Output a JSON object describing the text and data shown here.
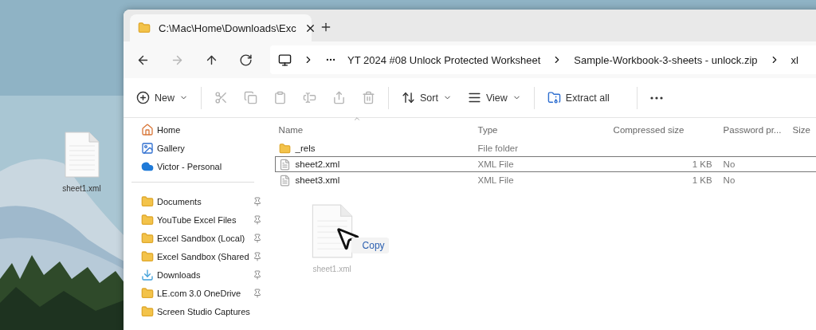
{
  "desktop": {
    "icons": [
      {
        "label": "sheet1.xml"
      }
    ]
  },
  "window": {
    "tabs": [
      {
        "label": "C:\\Mac\\Home\\Downloads\\Exc",
        "selected": true
      }
    ],
    "nav": [
      {
        "kind": "back",
        "disabled": false
      },
      {
        "kind": "forward",
        "disabled": true
      },
      {
        "kind": "up",
        "disabled": false
      },
      {
        "kind": "refresh",
        "disabled": false
      }
    ],
    "address": {
      "crumbs": [
        "YT 2024 #08 Unlock Protected Worksheet",
        "Sample-Workbook-3-sheets - unlock.zip",
        "xl"
      ]
    },
    "toolbar": [
      {
        "kind": "new",
        "label": "New",
        "disabled": false
      },
      {
        "kind": "cut",
        "disabled": true
      },
      {
        "kind": "copy",
        "disabled": true
      },
      {
        "kind": "paste",
        "disabled": true
      },
      {
        "kind": "rename",
        "disabled": true
      },
      {
        "kind": "share",
        "disabled": true
      },
      {
        "kind": "delete",
        "disabled": true
      },
      {
        "kind": "sort",
        "label": "Sort",
        "disabled": false
      },
      {
        "kind": "view",
        "label": "View",
        "disabled": false
      },
      {
        "kind": "extract",
        "label": "Extract all",
        "disabled": false
      },
      {
        "kind": "more",
        "disabled": false
      }
    ],
    "sidebar": {
      "top": [
        {
          "kind": "home",
          "label": "Home"
        },
        {
          "kind": "gallery",
          "label": "Gallery"
        },
        {
          "kind": "cloud",
          "label": "Victor - Personal"
        }
      ],
      "quick": [
        {
          "kind": "folder",
          "label": "Documents",
          "pinned": true
        },
        {
          "kind": "folder",
          "label": "YouTube Excel Files",
          "pinned": true
        },
        {
          "kind": "folder",
          "label": "Excel Sandbox (Local)",
          "pinned": true
        },
        {
          "kind": "folder",
          "label": "Excel Sandbox (Shared",
          "pinned": true
        },
        {
          "kind": "downloads",
          "label": "Downloads",
          "pinned": true
        },
        {
          "kind": "folder",
          "label": "LE.com 3.0 OneDrive",
          "pinned": true
        },
        {
          "kind": "folder",
          "label": "Screen Studio Captures",
          "pinned": false
        }
      ]
    },
    "table": {
      "columns": [
        "Name",
        "Type",
        "Compressed size",
        "Password pr...",
        "Size"
      ],
      "rows": [
        {
          "kind": "folder",
          "name": "_rels",
          "type": "File folder",
          "focused": false
        },
        {
          "kind": "file",
          "name": "sheet2.xml",
          "type": "XML File",
          "compressed": "1 KB",
          "password": "No",
          "focused": true
        },
        {
          "kind": "file",
          "name": "sheet3.xml",
          "type": "XML File",
          "compressed": "1 KB",
          "password": "No",
          "focused": false
        }
      ]
    }
  },
  "drag": {
    "label": "sheet1.xml",
    "action": "Copy"
  }
}
